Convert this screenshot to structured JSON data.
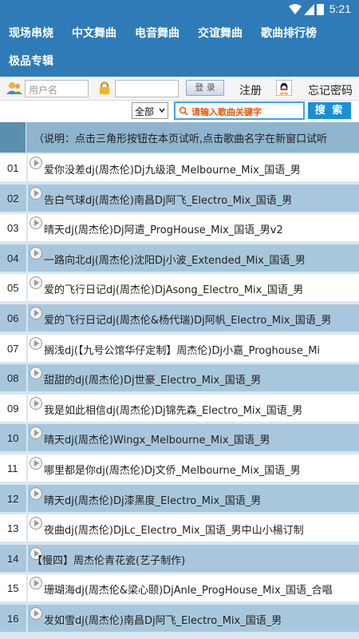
{
  "status_bar": {
    "time": "5:21"
  },
  "nav": {
    "items": [
      "现场串烧",
      "中文舞曲",
      "电音舞曲",
      "交谊舞曲",
      "歌曲排行榜",
      "极品专辑"
    ]
  },
  "login": {
    "username_placeholder": "用户名",
    "login_label": "登 录",
    "register_label": "注册",
    "forgot_label": "忘记密码"
  },
  "search": {
    "category_selected": "全部",
    "placeholder": "请输入歌曲关键字",
    "button_label": "搜 索"
  },
  "table": {
    "header_text": "（说明：点击三角形按钮在本页试听,点击歌曲名字在新窗口试听",
    "rows": [
      {
        "num": "01",
        "title": "爱你没差dj(周杰伦)Dj九级浪_Melbourne_Mix_国语_男"
      },
      {
        "num": "02",
        "title": "告白气球dj(周杰伦)南昌Dj阿飞_Electro_Mix_国语_男"
      },
      {
        "num": "03",
        "title": "晴天dj(周杰伦)Dj阿遣_ProgHouse_Mix_国语_男v2"
      },
      {
        "num": "04",
        "title": "一路向北dj(周杰伦)沈阳Dj小波_Extended_Mix_国语_男"
      },
      {
        "num": "05",
        "title": "爱的飞行日记dj(周杰伦)DjAsong_Electro_Mix_国语_男"
      },
      {
        "num": "06",
        "title": "爱的飞行日记dj(周杰伦&杨代瑞)Dj阿帆_Electro_Mix_国语_男"
      },
      {
        "num": "07",
        "title": "搁浅dj(【九号公馆华仔定制】周杰伦)Dj小嘉_Proghouse_Mi"
      },
      {
        "num": "08",
        "title": "甜甜的dj(周杰伦)Dj世豪_Electro_Mix_国语_男"
      },
      {
        "num": "09",
        "title": "我是如此相信dj(周杰伦)Dj锦先森_Electro_Mix_国语_男"
      },
      {
        "num": "10",
        "title": "晴天dj(周杰伦)Wingx_Melbourne_Mix_国语_男"
      },
      {
        "num": "11",
        "title": "哪里都是你dj(周杰伦)Dj文侨_Melbourne_Mix_国语_男"
      },
      {
        "num": "12",
        "title": "晴天dj(周杰伦)Dj漆黑度_Electro_Mix_国语_男"
      },
      {
        "num": "13",
        "title": "夜曲dj(周杰伦)DjLc_Electro_Mix_国语_男中山小楊订制"
      },
      {
        "num": "14",
        "title": "【慢四】周杰伦青花瓷(艺子制作)"
      },
      {
        "num": "15",
        "title": "珊瑚海dj(周杰伦&梁心颐)DjAnle_ProgHouse_Mix_国语_合唱"
      },
      {
        "num": "16",
        "title": "发如雪dj(周杰伦)南昌Dj阿飞_Electro_Mix_国语_男"
      }
    ]
  },
  "colors": {
    "nav_bg": "#2e7bb8",
    "row_alt": "#a9c7dc",
    "search_btn": "#1a8fd8"
  }
}
